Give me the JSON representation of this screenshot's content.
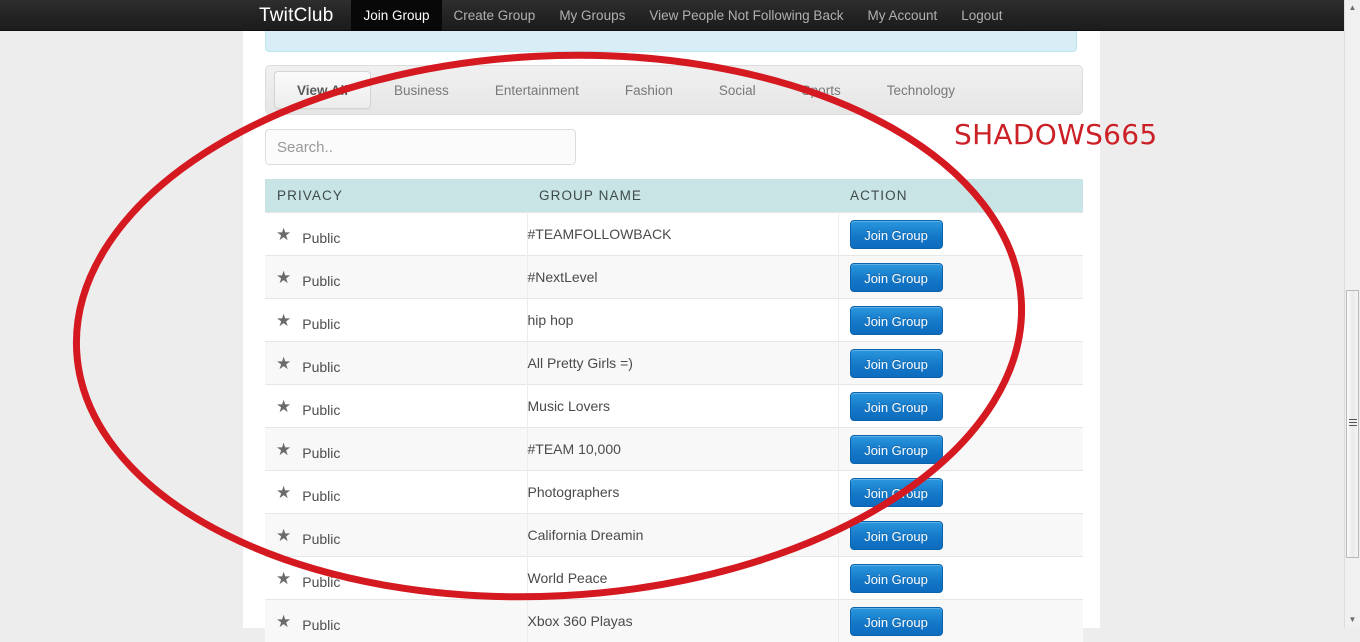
{
  "navbar": {
    "brand": "TwitClub",
    "links": [
      {
        "label": "Join Group",
        "active": true
      },
      {
        "label": "Create Group",
        "active": false
      },
      {
        "label": "My Groups",
        "active": false
      },
      {
        "label": "View People Not Following Back",
        "active": false
      },
      {
        "label": "My Account",
        "active": false
      },
      {
        "label": "Logout",
        "active": false
      }
    ]
  },
  "tabs": [
    {
      "label": "View All",
      "active": true
    },
    {
      "label": "Business",
      "active": false
    },
    {
      "label": "Entertainment",
      "active": false
    },
    {
      "label": "Fashion",
      "active": false
    },
    {
      "label": "Social",
      "active": false
    },
    {
      "label": "Sports",
      "active": false
    },
    {
      "label": "Technology",
      "active": false
    }
  ],
  "search": {
    "placeholder": "Search..",
    "value": ""
  },
  "table": {
    "columns": [
      "PRIVACY",
      "GROUP NAME",
      "ACTION"
    ],
    "action_label": "Join Group",
    "star_icon": "star-icon",
    "rows": [
      {
        "privacy": "Public",
        "name": "#TEAMFOLLOWBACK"
      },
      {
        "privacy": "Public",
        "name": "#NextLevel"
      },
      {
        "privacy": "Public",
        "name": "hip hop"
      },
      {
        "privacy": "Public",
        "name": "All Pretty Girls =)"
      },
      {
        "privacy": "Public",
        "name": "Music Lovers"
      },
      {
        "privacy": "Public",
        "name": "#TEAM 10,000"
      },
      {
        "privacy": "Public",
        "name": "Photographers"
      },
      {
        "privacy": "Public",
        "name": "California Dreamin"
      },
      {
        "privacy": "Public",
        "name": "World Peace"
      },
      {
        "privacy": "Public",
        "name": "Xbox 360 Playas"
      }
    ]
  },
  "annotation": {
    "watermark": "SHADOWS665",
    "ellipse_color": "#d51920",
    "watermark_color": "#cc2027"
  },
  "scrollbar": {
    "up_arrow": "▲",
    "down_arrow": "▼"
  },
  "colors": {
    "navbar_bg": "#222222",
    "table_header_bg": "#c9e4e4",
    "button_blue": "#1578c8",
    "alert_bg": "#d9edf7"
  }
}
